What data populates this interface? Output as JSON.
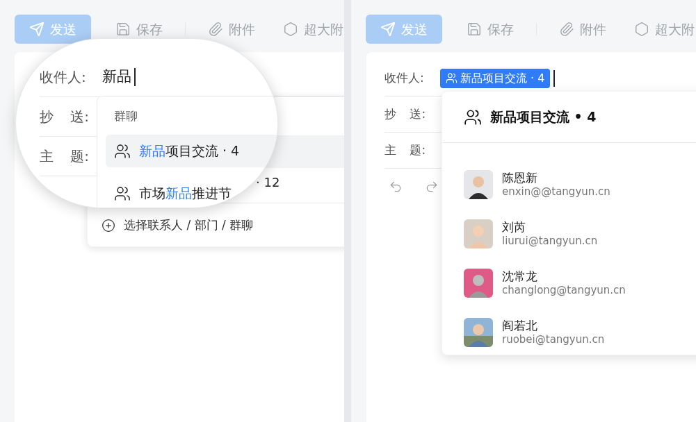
{
  "left_panel": {
    "toolbar": [
      {
        "kind": "send",
        "label": "发送",
        "disabled": true
      },
      {
        "kind": "save",
        "label": "保存"
      },
      {
        "kind": "attach",
        "label": "附件"
      },
      {
        "kind": "large",
        "label": "超大附"
      }
    ],
    "magnifier": {
      "fields": [
        {
          "label": "收件人:",
          "value": "新品"
        },
        {
          "label": "抄 送:"
        },
        {
          "label": "主 题:"
        }
      ],
      "suggestions": {
        "heading": "群聊",
        "items": [
          {
            "selected": true,
            "parts": [
              {
                "text": "新品",
                "match": true
              },
              {
                "text": "项目交流 · 4",
                "match": false
              }
            ]
          },
          {
            "selected": false,
            "parts": [
              {
                "text": "市场",
                "match": false
              },
              {
                "text": "新品",
                "match": true
              },
              {
                "text": "推进节",
                "match": false
              }
            ]
          }
        ]
      }
    },
    "item_tail": "· 12",
    "footer_action": "选择联系人 / 部门 / 群聊"
  },
  "right_panel": {
    "toolbar": [
      {
        "kind": "send",
        "label": "发送",
        "disabled": true
      },
      {
        "kind": "save",
        "label": "保存"
      },
      {
        "kind": "attach",
        "label": "附件"
      },
      {
        "kind": "large",
        "label": "超大附"
      }
    ],
    "fields": [
      {
        "label": "收件人:",
        "chip": "新品项目交流 · 4"
      },
      {
        "label": "抄 送:"
      },
      {
        "label": "主 题:"
      }
    ],
    "group_card": {
      "title": "新品项目交流 • 4",
      "members": [
        {
          "name": "陈恩新",
          "email": "enxin@@tangyun.cn"
        },
        {
          "name": "刘芮",
          "email": "liurui@tangyun.cn"
        },
        {
          "name": "沈常龙",
          "email": "changlong@tangyun.cn"
        },
        {
          "name": "阎若北",
          "email": "ruobei@tangyun.cn"
        }
      ]
    }
  }
}
